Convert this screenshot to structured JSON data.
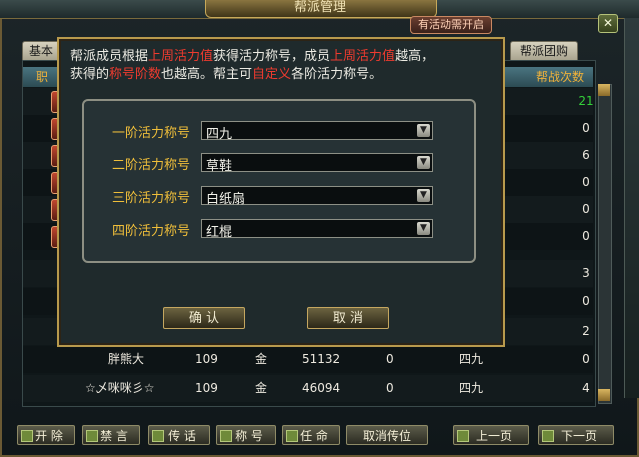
{
  "window": {
    "title": "帮派管理",
    "event_badge": "有活动需开启",
    "close_glyph": "✕"
  },
  "tabs": {
    "basic": "基本",
    "group_buy": "帮派团购"
  },
  "table": {
    "header_left": "职",
    "header_right": "帮战次数",
    "counts": [
      "21",
      "0",
      "6",
      "0",
      "0",
      "0",
      "3",
      "0",
      "2",
      "0",
      "4"
    ],
    "rows": [
      {
        "name": "胖熊大",
        "level": "109",
        "element": "金",
        "contribution": "51132",
        "other": "0",
        "title": "四九"
      },
      {
        "name": "☆乄咪咪彡☆",
        "level": "109",
        "element": "金",
        "contribution": "46094",
        "other": "0",
        "title": "四九"
      }
    ]
  },
  "buttons": {
    "expel": "开 除",
    "mute": "禁 言",
    "message": "传 话",
    "title": "称 号",
    "appoint": "任 命",
    "cancel_pass": "取消传位",
    "prev_page": "上一页",
    "next_page": "下一页"
  },
  "dialog": {
    "line1_a": "帮派成员根据",
    "line1_b": "上周活力值",
    "line1_c": "获得活力称号，成员",
    "line1_d": "上周活力值",
    "line1_e": "越高，",
    "line2_a": "获得的",
    "line2_b": "称号阶数",
    "line2_c": "也越高。帮主可",
    "line2_d": "自定义",
    "line2_e": "各阶活力称号。",
    "levels": [
      {
        "label": "一阶活力称号",
        "value": "四九"
      },
      {
        "label": "二阶活力称号",
        "value": "草鞋"
      },
      {
        "label": "三阶活力称号",
        "value": "白纸扇"
      },
      {
        "label": "四阶活力称号",
        "value": "红棍"
      }
    ],
    "confirm": "确 认",
    "cancel": "取 消"
  }
}
